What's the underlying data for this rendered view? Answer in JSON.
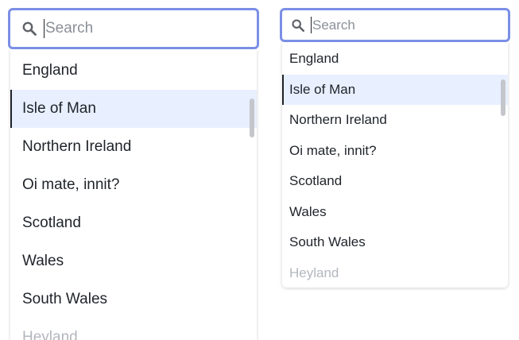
{
  "search_large": {
    "placeholder": "Search",
    "value": "",
    "icon": "search-icon"
  },
  "list_large": {
    "options": [
      "England",
      "Isle of Man",
      "Northern Ireland",
      "Oi mate, innit?",
      "Scotland",
      "Wales",
      "South Wales",
      "Heyland"
    ],
    "active_option": "Isle of Man"
  },
  "search_small": {
    "placeholder": "Search",
    "value": "",
    "icon": "search-icon"
  },
  "list_small": {
    "options": [
      "England",
      "Isle of Man",
      "Northern Ireland",
      "Oi mate, innit?",
      "Scotland",
      "Wales",
      "South Wales",
      "Heyland"
    ],
    "active_option": "Isle of Man"
  },
  "colors": {
    "focus_border": "#7b8fe6",
    "active_row": "#e8efff",
    "text": "#1f2329",
    "faded_text": "#b3b7bd"
  }
}
